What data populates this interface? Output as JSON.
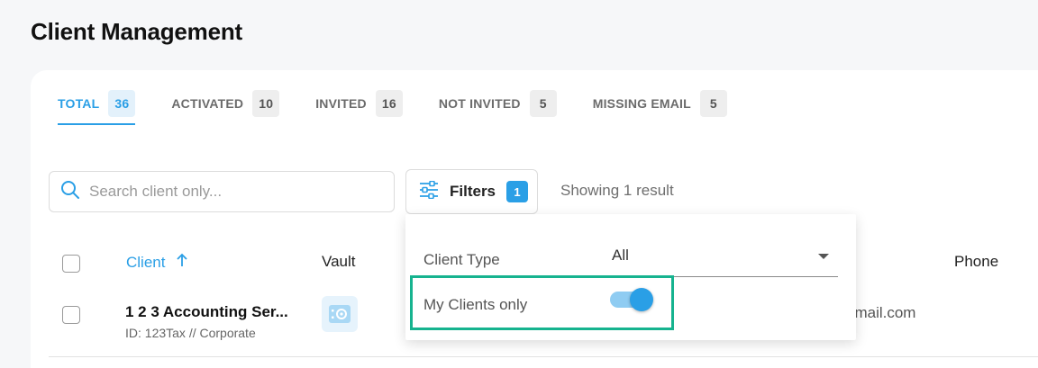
{
  "page": {
    "title": "Client Management"
  },
  "tabs": [
    {
      "label": "TOTAL",
      "count": "36",
      "active": true
    },
    {
      "label": "ACTIVATED",
      "count": "10"
    },
    {
      "label": "INVITED",
      "count": "16"
    },
    {
      "label": "NOT INVITED",
      "count": "5"
    },
    {
      "label": "MISSING EMAIL",
      "count": "5"
    }
  ],
  "toolbar": {
    "search_placeholder": "Search client only...",
    "filters_label": "Filters",
    "filters_count": "1",
    "result_text": "Showing 1 result"
  },
  "table": {
    "headers": {
      "client": "Client",
      "vault": "Vault",
      "phone": "Phone"
    },
    "sort_icon": "arrow-up-icon",
    "rows": [
      {
        "name": "1 2 3 Accounting Ser...",
        "sub": "ID: 123Tax // Corporate",
        "email_fragment": "gmail.com"
      }
    ]
  },
  "filter_panel": {
    "client_type_label": "Client Type",
    "client_type_value": "All",
    "my_clients_label": "My Clients only",
    "my_clients_on": true
  },
  "colors": {
    "accent": "#2a9fe6",
    "highlight": "#16b38f"
  }
}
